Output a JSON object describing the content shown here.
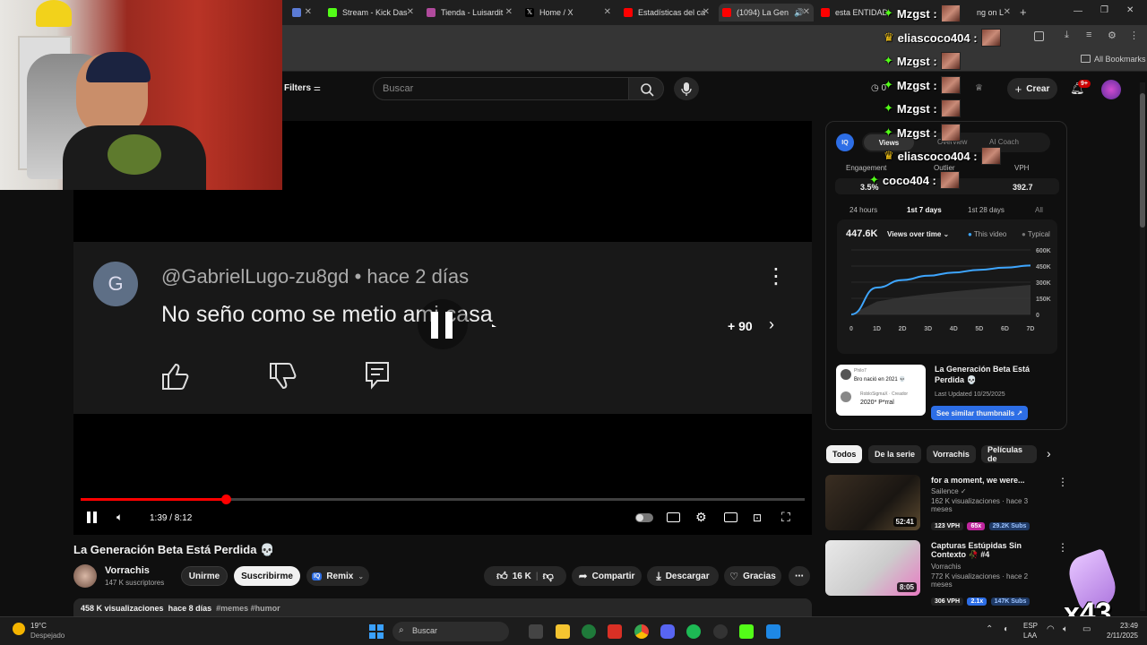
{
  "browser": {
    "tabs": [
      {
        "label": "Stream - Kick Das"
      },
      {
        "label": "Tienda - Luisardit"
      },
      {
        "label": "Home / X"
      },
      {
        "label": "Estadísticas del ca"
      },
      {
        "label": "(1094) La Gen"
      },
      {
        "label": "esta ENTIDAD"
      },
      {
        "label": "ng on L"
      }
    ],
    "bookmarks_label": "All Bookmarks"
  },
  "youtube": {
    "filters_label": "Filters",
    "search_placeholder": "Buscar",
    "create_label": "Crear",
    "notif_count": "9+",
    "watch_count": "0"
  },
  "player": {
    "comment_author": "@GabrielLugo-zu8gd",
    "comment_time": "hace 2 días",
    "comment_text": "No seño como se metio ami casa",
    "comment_avatar_letter": "G",
    "more_count": "+ 90",
    "time_display": "1:39 / 8:12",
    "progress": 0.2
  },
  "video": {
    "title": "La Generación Beta Está Perdida 💀",
    "channel": "Vorrachis",
    "subscribers": "147 K suscriptores",
    "join_label": "Unirme",
    "subscribe_label": "Suscribirme",
    "remix_label": "Remix",
    "likes": "16 K",
    "share_label": "Compartir",
    "download_label": "Descargar",
    "thanks_label": "Gracias",
    "views": "458 K visualizaciones",
    "posted": "hace 8 días",
    "hashtags": "#memes #humor"
  },
  "analytics": {
    "tabs": [
      "Views",
      "Overview",
      "AI Coach"
    ],
    "metrics_labels": [
      "Engagement",
      "Outlier",
      "VPH"
    ],
    "engagement": "3.5%",
    "vph": "392.7",
    "ranges": [
      "24 hours",
      "1st 7 days",
      "1st 28 days",
      "All"
    ],
    "total_views": "447.6K",
    "dropdown": "Views over time",
    "legend_this": "This video",
    "legend_typical": "Typical",
    "thumb_title": "La Generación Beta Está Perdida 💀",
    "last_updated": "Last Updated 10/25/2025",
    "see_similar": "See similar thumbnails ↗",
    "thumb_comment1_user": "Philo7",
    "thumb_comment1": "Bro nació en 2021 💀",
    "thumb_comment2_user": "RobloSigmaX · Creador",
    "thumb_comment2": "2020* P*rral"
  },
  "chart_data": {
    "type": "area",
    "x": [
      "0",
      "1D",
      "2D",
      "3D",
      "4D",
      "5D",
      "6D",
      "7D"
    ],
    "y_ticks": [
      "600K",
      "450K",
      "300K",
      "150K",
      "0"
    ],
    "ylim": [
      0,
      600000
    ],
    "series": [
      {
        "name": "This video",
        "values": [
          0,
          250000,
          320000,
          360000,
          390000,
          415000,
          435000,
          455000
        ]
      },
      {
        "name": "Typical",
        "values": [
          0,
          120000,
          160000,
          190000,
          215000,
          235000,
          255000,
          275000
        ]
      }
    ],
    "legend": "top-right"
  },
  "chips": [
    "Todos",
    "De la serie",
    "Vorrachis",
    "Películas de"
  ],
  "recommendations": [
    {
      "title": "for a moment, we were...",
      "channel": "Sailence",
      "meta": "162 K visualizaciones · hace 3 meses",
      "vph": "123 VPH",
      "outlier": "65x",
      "subs": "29.2K Subs",
      "duration": "52:41"
    },
    {
      "title": "Capturas Estúpidas Sin Contexto 🥀 #4",
      "channel": "Vorrachis",
      "meta": "772 K visualizaciones · hace 2 meses",
      "vph": "306 VPH",
      "outlier": "2.1x",
      "subs": "147K Subs",
      "duration": "8:05"
    }
  ],
  "chat": [
    {
      "user": "Mzgst :"
    },
    {
      "user": "eliascoco404 :"
    },
    {
      "user": "Mzgst :"
    },
    {
      "user": "Mzgst :"
    },
    {
      "user": "Mzgst :"
    },
    {
      "user": "Mzgst :"
    },
    {
      "user": "eliascoco404 :"
    },
    {
      "user": "coco404 :"
    }
  ],
  "overlay": {
    "combo": "x43"
  },
  "taskbar": {
    "weather_temp": "19°C",
    "weather_desc": "Despejado",
    "search_label": "Buscar",
    "lang1": "ESP",
    "lang2": "LAA",
    "time": "23:49",
    "date": "2/11/2025"
  }
}
